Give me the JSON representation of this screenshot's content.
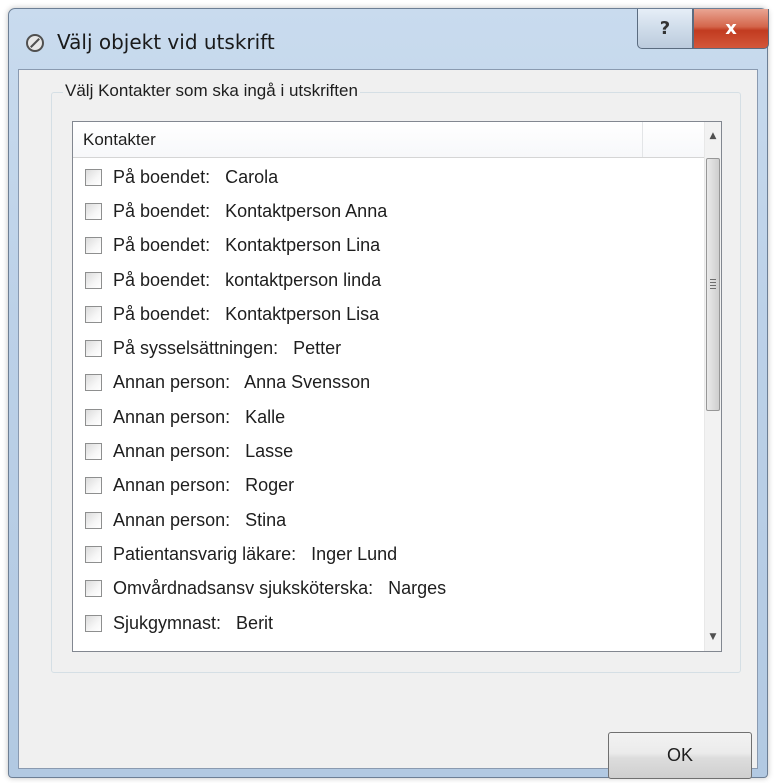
{
  "window": {
    "title": "Välj objekt vid utskrift",
    "help_label": "?",
    "close_label": "x"
  },
  "group": {
    "label": "Välj Kontakter som ska ingå i utskriften"
  },
  "list": {
    "column_header": "Kontakter",
    "items": [
      {
        "label": "På boendet:   Carola",
        "checked": false
      },
      {
        "label": "På boendet:   Kontaktperson Anna",
        "checked": false
      },
      {
        "label": "På boendet:   Kontaktperson Lina",
        "checked": false
      },
      {
        "label": "På boendet:   kontaktperson linda",
        "checked": false
      },
      {
        "label": "På boendet:   Kontaktperson Lisa",
        "checked": false
      },
      {
        "label": "På sysselsättningen:   Petter",
        "checked": false
      },
      {
        "label": "Annan person:   Anna Svensson",
        "checked": false
      },
      {
        "label": "Annan person:   Kalle",
        "checked": false
      },
      {
        "label": "Annan person:   Lasse",
        "checked": false
      },
      {
        "label": "Annan person:   Roger",
        "checked": false
      },
      {
        "label": "Annan person:   Stina",
        "checked": false
      },
      {
        "label": "Patientansvarig läkare:   Inger Lund",
        "checked": false
      },
      {
        "label": "Omvårdnadsansv sjuksköterska:   Narges",
        "checked": false
      },
      {
        "label": "Sjukgymnast:   Berit",
        "checked": false
      }
    ]
  },
  "buttons": {
    "ok_label": "OK"
  }
}
